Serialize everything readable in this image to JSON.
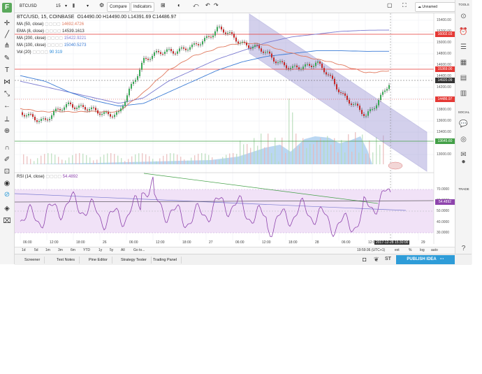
{
  "app": {
    "logo": "F"
  },
  "topbar": {
    "symbol": "BTCUSD",
    "interval": "15",
    "compare": "Compare",
    "indicators": "Indicators",
    "unnamed": "Unnamed"
  },
  "legend": {
    "title": "BTC/USD, 15, COINBASE",
    "ohlc": "O14490.00  H14490.00  L14391.69  C14486.97",
    "rows": [
      {
        "label": "MA (50, close)",
        "value": "14692.4726",
        "color": "#e07a5f"
      },
      {
        "label": "EMA (8, close)",
        "value": "14539.1613",
        "color": "#333333"
      },
      {
        "label": "MA (200, close)",
        "value": "15422.9221",
        "color": "#7a7ad0"
      },
      {
        "label": "MA (100, close)",
        "value": "15040.5273",
        "color": "#3a7bd5"
      },
      {
        "label": "Vol (20)",
        "value": "90   319",
        "color": "#2a8ad8"
      }
    ],
    "rsi_label": "RSI (14, close)",
    "rsi_value": "54.4892"
  },
  "price_axis": {
    "labels": [
      "15400.00",
      "15200.00",
      "15000.00",
      "14800.00",
      "14600.00",
      "14400.00",
      "14200.00",
      "14000.00",
      "13800.00",
      "13600.00",
      "13400.00",
      "13200.00",
      "13000.00"
    ],
    "marked": [
      {
        "text": "16002.03",
        "color": "#e53935"
      },
      {
        "text": "15369.00",
        "color": "#e53935"
      },
      {
        "text": "14920.09",
        "color": "#333333"
      },
      {
        "text": "14486.97",
        "color": "#e53935"
      },
      {
        "text": "13645.60",
        "color": "#43a047"
      }
    ]
  },
  "rsi_axis": {
    "labels": [
      "70.0000",
      "60.0000",
      "50.0000",
      "40.0000",
      "30.0000"
    ],
    "marked": "54.4892"
  },
  "time_axis": {
    "labels": [
      "06:00",
      "12:00",
      "18:00",
      "26",
      "06:00",
      "12:00",
      "18:00",
      "27",
      "06:00",
      "12:00",
      "18:00",
      "28",
      "06:00",
      "12:00",
      "18:00",
      "29"
    ],
    "crosshair": "2017-12-28 15:30:00"
  },
  "chart_data": {
    "type": "line",
    "title": "BTC/USD, 15, COINBASE",
    "ylabel": "",
    "xlabel": "",
    "ylim": [
      13000,
      15600
    ],
    "x": [
      "25 00:00",
      "25 06:00",
      "25 12:00",
      "25 18:00",
      "26 00:00",
      "26 06:00",
      "26 12:00",
      "26 18:00",
      "27 00:00",
      "27 06:00",
      "27 12:00",
      "27 18:00",
      "28 00:00",
      "28 06:00",
      "28 12:00",
      "28 15:30"
    ],
    "series": [
      {
        "name": "",
        "values": [
          13900,
          13800,
          14100,
          13950,
          13900,
          14900,
          15050,
          15100,
          15450,
          15200,
          15000,
          14700,
          14850,
          14300,
          13850,
          14487
        ]
      },
      {
        "name": "MA (50, close)",
        "values": [
          14000,
          13950,
          13950,
          13950,
          13950,
          14300,
          14700,
          14950,
          15100,
          15200,
          15150,
          15000,
          14900,
          14800,
          14650,
          14692
        ]
      },
      {
        "name": "MA (200, close)",
        "values": [
          14500,
          14400,
          14300,
          14200,
          14100,
          14200,
          14500,
          14700,
          14900,
          15050,
          15200,
          15300,
          15350,
          15400,
          15420,
          15423
        ]
      },
      {
        "name": "MA (100, close)",
        "values": [
          14600,
          14500,
          14300,
          14150,
          14050,
          14100,
          14300,
          14500,
          14700,
          14850,
          14950,
          15000,
          15050,
          15050,
          15040,
          15041
        ]
      }
    ]
  },
  "bottom": {
    "timeframes": [
      "1d",
      "5d",
      "1m",
      "3m",
      "6m",
      "YTD",
      "1y",
      "5y",
      "All",
      "Go to..."
    ],
    "clock": "19:59:36 (UTC+1)",
    "opts": [
      "ext",
      "%",
      "log",
      "auto"
    ]
  },
  "panels": [
    "Screener",
    "Text Notes",
    "Pine Editor",
    "Strategy Tester",
    "Trading Panel"
  ],
  "publish": "PUBLISH IDEA",
  "rightbar": {
    "tools": "TOOLS",
    "social": "SOCIAL",
    "trade": "TRADE"
  }
}
